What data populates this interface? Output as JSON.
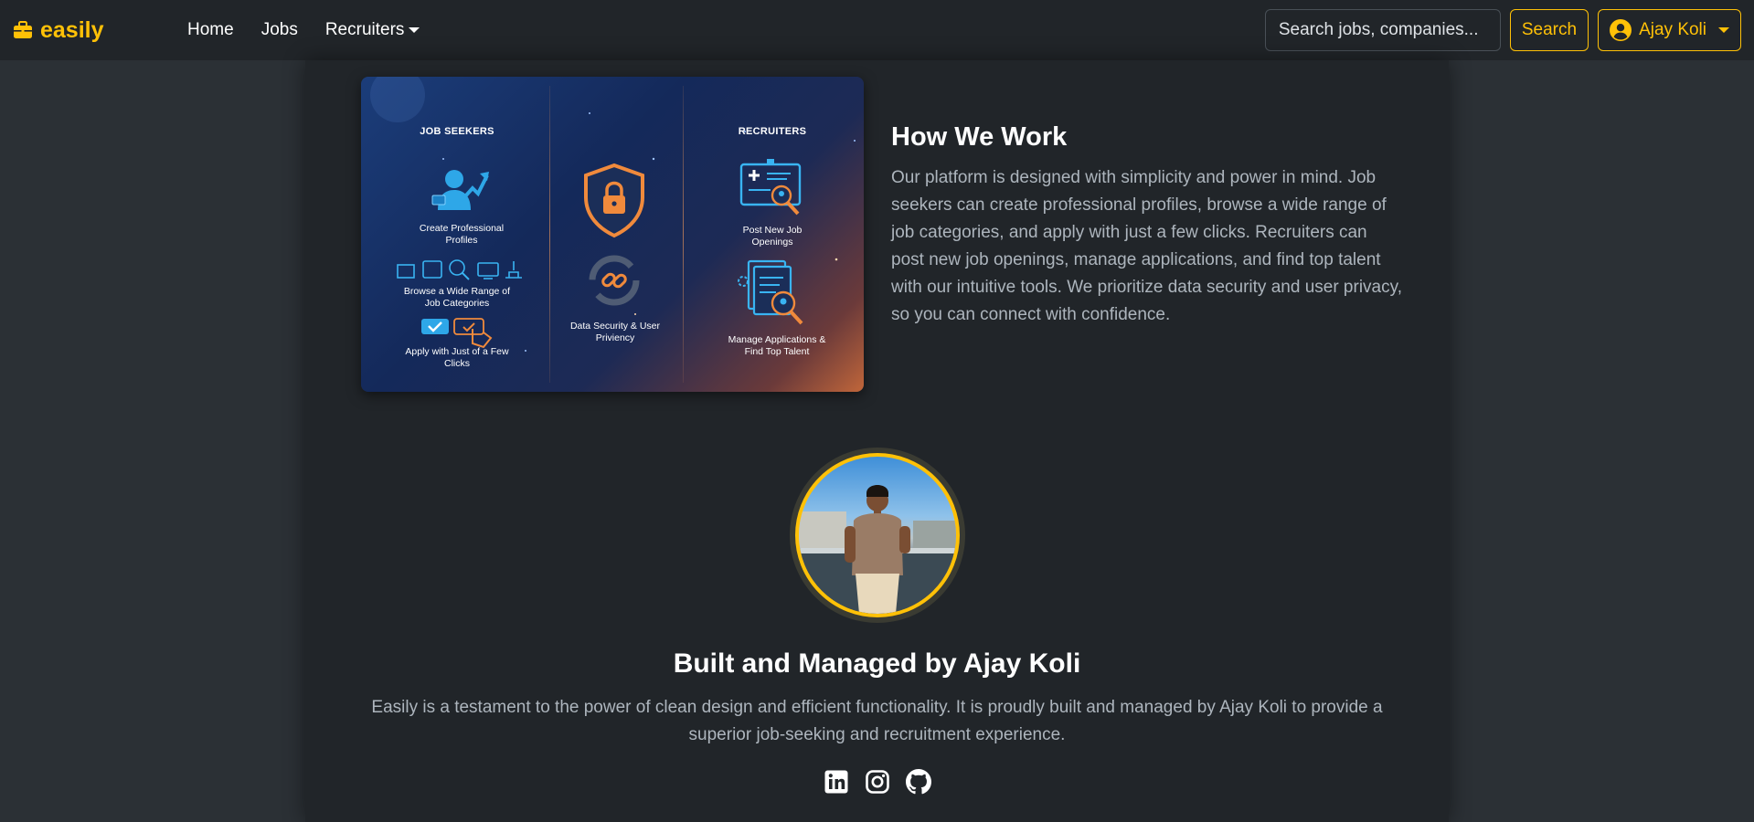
{
  "nav": {
    "brand": "easily",
    "links": [
      "Home",
      "Jobs",
      "Recruiters"
    ],
    "search_placeholder": "Search jobs, companies...",
    "search_button": "Search",
    "user_name": "Ajay Koli",
    "accent_color": "#ffc107"
  },
  "how_we_work": {
    "image": {
      "job_seekers_heading": "JOB SEEKERS",
      "recruiters_heading": "RECRUITERS",
      "captions": [
        "Create Professional Profiles",
        "Browse a Wide Range of Job Categories",
        "Apply with Just of a Few Clicks",
        "Data Security & User Priviency",
        "Post New Job Openings",
        "Manage Applications & Find Top Talent"
      ]
    },
    "title": "How We Work",
    "text": "Our platform is designed with simplicity and power in mind. Job seekers can create professional profiles, browse a wide range of job categories, and apply with just a few clicks. Recruiters can post new job openings, manage applications, and find top talent with our intuitive tools. We prioritize data security and user privacy, so you can connect with confidence."
  },
  "profile": {
    "title": "Built and Managed by Ajay Koli",
    "text": "Easily is a testament to the power of clean design and efficient functionality. It is proudly built and managed by Ajay Koli to provide a superior job-seeking and recruitment experience.",
    "socials": [
      "linkedin-icon",
      "instagram-icon",
      "github-icon"
    ]
  }
}
